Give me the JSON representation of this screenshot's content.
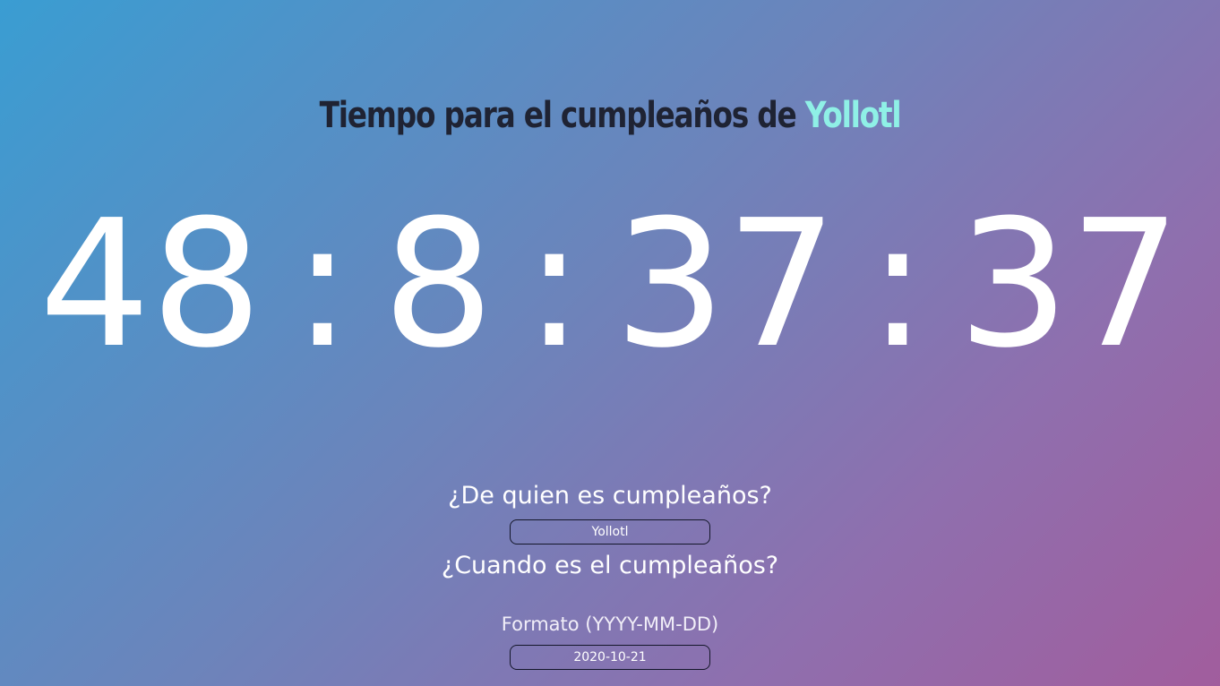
{
  "header": {
    "title_prefix": "Tiempo para el cumpleaños de",
    "name": "Yollotl",
    "name_color": "#8ff0e6"
  },
  "countdown": {
    "days": "48",
    "hours": "8",
    "minutes": "37",
    "seconds": "37",
    "separator": ":"
  },
  "form": {
    "name_question": "¿De quien es cumpleaños?",
    "name_value": "Yollotl",
    "date_question": "¿Cuando es el cumpleaños?",
    "date_format_hint": "Formato (YYYY-MM-DD)",
    "date_value": "2020-10-21"
  },
  "colors": {
    "gradient_start": "#3a9dd2",
    "gradient_end": "#a15d9d",
    "title_text": "#1f2333"
  }
}
